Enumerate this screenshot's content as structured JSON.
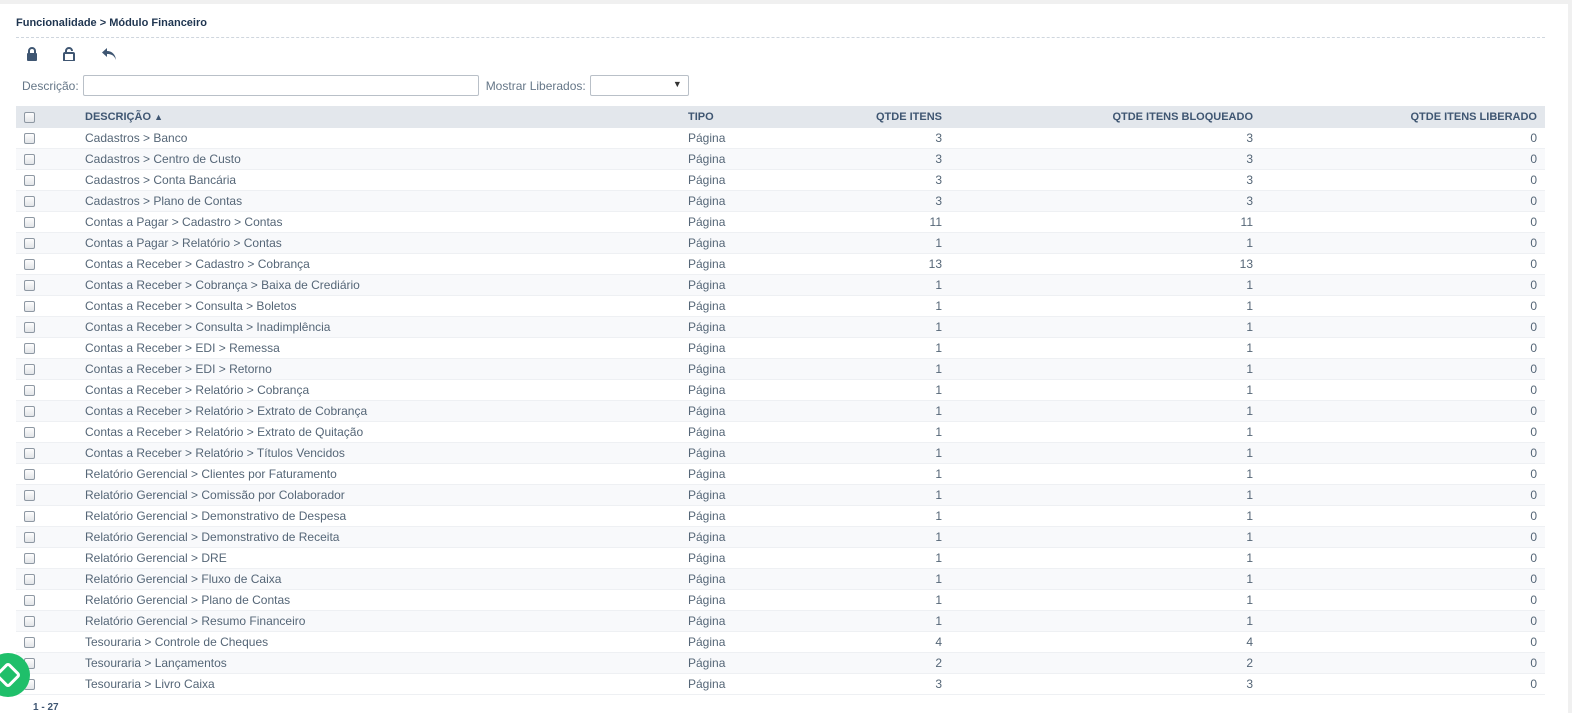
{
  "breadcrumb": "Funcionalidade > Módulo Financeiro",
  "toolbar": {
    "lock_icon": "lock-icon",
    "unlock_icon": "unlock-icon",
    "back_icon": "reply-arrow-icon"
  },
  "filters": {
    "descricao_label": "Descrição:",
    "descricao_value": "",
    "mostrar_label": "Mostrar Liberados:",
    "mostrar_value": ""
  },
  "table": {
    "columns": [
      "DESCRIÇÃO",
      "TIPO",
      "QTDE ITENS",
      "QTDE ITENS BLOQUEADO",
      "QTDE ITENS LIBERADO"
    ],
    "sort_indicator": "▲",
    "rows": [
      {
        "descricao": "Cadastros > Banco",
        "tipo": "Página",
        "qtde": "3",
        "bloqueado": "3",
        "liberado": "0"
      },
      {
        "descricao": "Cadastros > Centro de Custo",
        "tipo": "Página",
        "qtde": "3",
        "bloqueado": "3",
        "liberado": "0"
      },
      {
        "descricao": "Cadastros > Conta Bancária",
        "tipo": "Página",
        "qtde": "3",
        "bloqueado": "3",
        "liberado": "0"
      },
      {
        "descricao": "Cadastros > Plano de Contas",
        "tipo": "Página",
        "qtde": "3",
        "bloqueado": "3",
        "liberado": "0"
      },
      {
        "descricao": "Contas a Pagar > Cadastro > Contas",
        "tipo": "Página",
        "qtde": "11",
        "bloqueado": "11",
        "liberado": "0"
      },
      {
        "descricao": "Contas a Pagar > Relatório > Contas",
        "tipo": "Página",
        "qtde": "1",
        "bloqueado": "1",
        "liberado": "0"
      },
      {
        "descricao": "Contas a Receber > Cadastro > Cobrança",
        "tipo": "Página",
        "qtde": "13",
        "bloqueado": "13",
        "liberado": "0"
      },
      {
        "descricao": "Contas a Receber > Cobrança > Baixa de Crediário",
        "tipo": "Página",
        "qtde": "1",
        "bloqueado": "1",
        "liberado": "0"
      },
      {
        "descricao": "Contas a Receber > Consulta > Boletos",
        "tipo": "Página",
        "qtde": "1",
        "bloqueado": "1",
        "liberado": "0"
      },
      {
        "descricao": "Contas a Receber > Consulta > Inadimplência",
        "tipo": "Página",
        "qtde": "1",
        "bloqueado": "1",
        "liberado": "0"
      },
      {
        "descricao": "Contas a Receber > EDI > Remessa",
        "tipo": "Página",
        "qtde": "1",
        "bloqueado": "1",
        "liberado": "0"
      },
      {
        "descricao": "Contas a Receber > EDI > Retorno",
        "tipo": "Página",
        "qtde": "1",
        "bloqueado": "1",
        "liberado": "0"
      },
      {
        "descricao": "Contas a Receber > Relatório > Cobrança",
        "tipo": "Página",
        "qtde": "1",
        "bloqueado": "1",
        "liberado": "0"
      },
      {
        "descricao": "Contas a Receber > Relatório > Extrato de Cobrança",
        "tipo": "Página",
        "qtde": "1",
        "bloqueado": "1",
        "liberado": "0"
      },
      {
        "descricao": "Contas a Receber > Relatório > Extrato de Quitação",
        "tipo": "Página",
        "qtde": "1",
        "bloqueado": "1",
        "liberado": "0"
      },
      {
        "descricao": "Contas a Receber > Relatório > Títulos Vencidos",
        "tipo": "Página",
        "qtde": "1",
        "bloqueado": "1",
        "liberado": "0"
      },
      {
        "descricao": "Relatório Gerencial > Clientes por Faturamento",
        "tipo": "Página",
        "qtde": "1",
        "bloqueado": "1",
        "liberado": "0"
      },
      {
        "descricao": "Relatório Gerencial > Comissão por Colaborador",
        "tipo": "Página",
        "qtde": "1",
        "bloqueado": "1",
        "liberado": "0"
      },
      {
        "descricao": "Relatório Gerencial > Demonstrativo de Despesa",
        "tipo": "Página",
        "qtde": "1",
        "bloqueado": "1",
        "liberado": "0"
      },
      {
        "descricao": "Relatório Gerencial > Demonstrativo de Receita",
        "tipo": "Página",
        "qtde": "1",
        "bloqueado": "1",
        "liberado": "0"
      },
      {
        "descricao": "Relatório Gerencial > DRE",
        "tipo": "Página",
        "qtde": "1",
        "bloqueado": "1",
        "liberado": "0"
      },
      {
        "descricao": "Relatório Gerencial > Fluxo de Caixa",
        "tipo": "Página",
        "qtde": "1",
        "bloqueado": "1",
        "liberado": "0"
      },
      {
        "descricao": "Relatório Gerencial > Plano de Contas",
        "tipo": "Página",
        "qtde": "1",
        "bloqueado": "1",
        "liberado": "0"
      },
      {
        "descricao": "Relatório Gerencial > Resumo Financeiro",
        "tipo": "Página",
        "qtde": "1",
        "bloqueado": "1",
        "liberado": "0"
      },
      {
        "descricao": "Tesouraria > Controle de Cheques",
        "tipo": "Página",
        "qtde": "4",
        "bloqueado": "4",
        "liberado": "0"
      },
      {
        "descricao": "Tesouraria > Lançamentos",
        "tipo": "Página",
        "qtde": "2",
        "bloqueado": "2",
        "liberado": "0"
      },
      {
        "descricao": "Tesouraria > Livro Caixa",
        "tipo": "Página",
        "qtde": "3",
        "bloqueado": "3",
        "liberado": "0"
      }
    ]
  },
  "pager": "1 - 27",
  "badge_icon": "app-badge-icon",
  "colors": {
    "header_bg": "#e3e7ec",
    "header_text": "#3f5672",
    "body_text": "#556677",
    "badge": "#1fbf6a"
  }
}
